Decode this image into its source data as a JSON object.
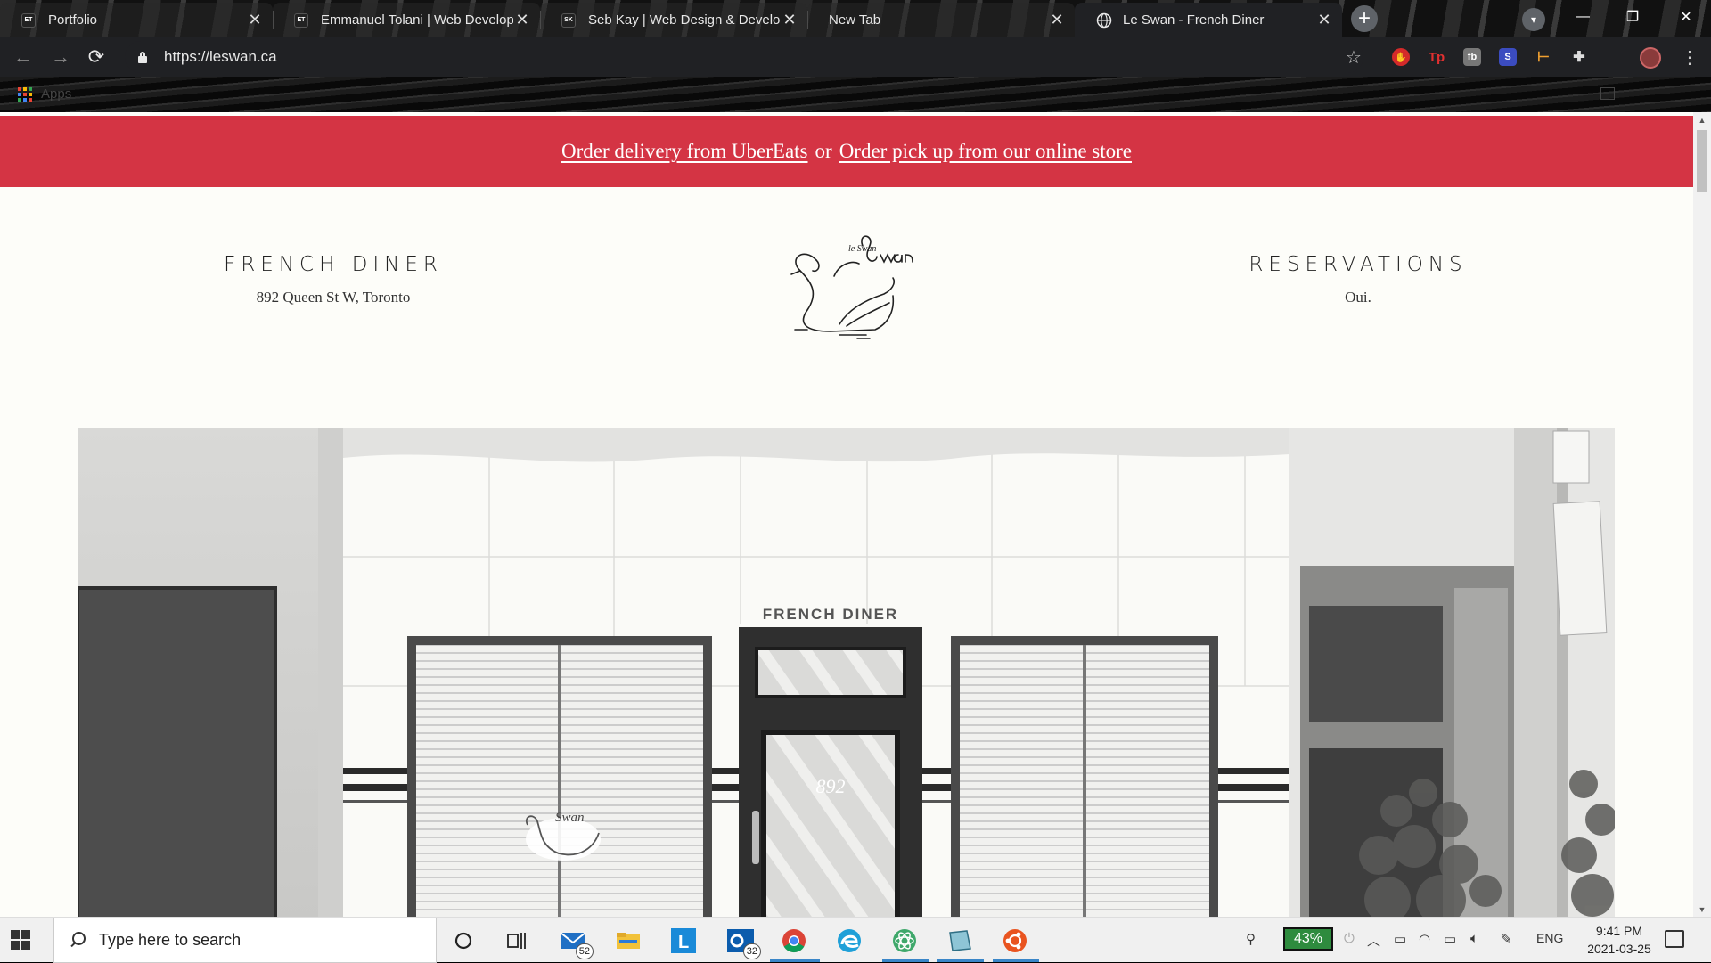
{
  "browser": {
    "tabs": [
      {
        "favicon": "ET",
        "title": "Portfolio",
        "active": false
      },
      {
        "favicon": "ET",
        "title": "Emmanuel Tolani | Web Developer",
        "active": false
      },
      {
        "favicon": "SK",
        "title": "Seb Kay | Web Design & Development",
        "active": false
      },
      {
        "favicon": "",
        "title": "New Tab",
        "active": false
      },
      {
        "favicon": "globe-icon",
        "title": "Le Swan - French Diner",
        "active": true
      }
    ],
    "close_glyph": "✕",
    "new_tab_glyph": "+",
    "url": "https://leswan.ca",
    "bookmarks_apps_label": "Apps"
  },
  "page": {
    "promo": {
      "link1": "Order delivery from UberEats",
      "connector": "or",
      "link2": "Order pick up from our online store",
      "background_color": "#d43444"
    },
    "left": {
      "heading": "FRENCH DINER",
      "sub": "892 Queen St W, Toronto"
    },
    "right": {
      "heading": "RESERVATIONS",
      "sub": "Oui."
    },
    "logo_text": "le Swan",
    "illustration": {
      "sign": "FRENCH DINER",
      "door_number": "892",
      "window_logo": "Swan"
    }
  },
  "taskbar": {
    "search_placeholder": "Type here to search",
    "mail_badge": "52",
    "outlook_badge": "32",
    "battery": "43%",
    "language": "ENG",
    "time": "9:41 PM",
    "date": "2021-03-25"
  }
}
